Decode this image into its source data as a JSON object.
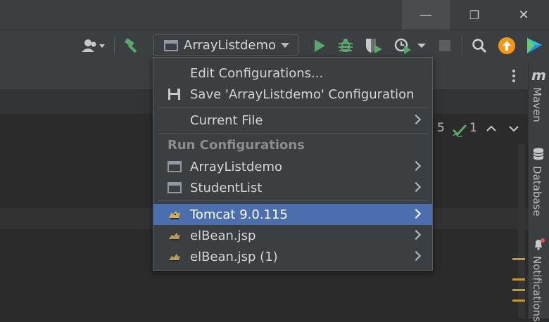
{
  "window": {
    "minimize_glyph": "—",
    "maximize_glyph": "❐",
    "close_glyph": "✕"
  },
  "toolbar": {
    "run_config_label": "ArrayListdemo",
    "icons": [
      "user-icon",
      "build-hammer-icon",
      "run-icon",
      "debug-icon",
      "coverage-icon",
      "profiler-icon",
      "stop-icon",
      "search-icon",
      "update-icon",
      "plugin-logo-icon"
    ]
  },
  "inspections": {
    "warnings": "5",
    "checks": "1"
  },
  "menu": {
    "edit_configurations": "Edit Configurations...",
    "save_configuration": "Save 'ArrayListdemo' Configuration",
    "current_file": "Current File",
    "run_configurations_header": "Run Configurations",
    "items": [
      {
        "label": "ArrayListdemo",
        "icon": "app-config-icon"
      },
      {
        "label": "StudentList",
        "icon": "app-config-icon"
      },
      {
        "label": "Tomcat 9.0.115",
        "icon": "tomcat-icon",
        "selected": true
      },
      {
        "label": "elBean.jsp",
        "icon": "tomcat-icon"
      },
      {
        "label": "elBean.jsp (1)",
        "icon": "tomcat-icon"
      }
    ]
  },
  "sidebar": {
    "maven": "Maven",
    "database": "Database",
    "notifications": "Notifications",
    "maven_glyph": "m"
  },
  "colors": {
    "selection": "#4b6eaf",
    "run_green": "#59a869",
    "accent_orange": "#f49810"
  }
}
